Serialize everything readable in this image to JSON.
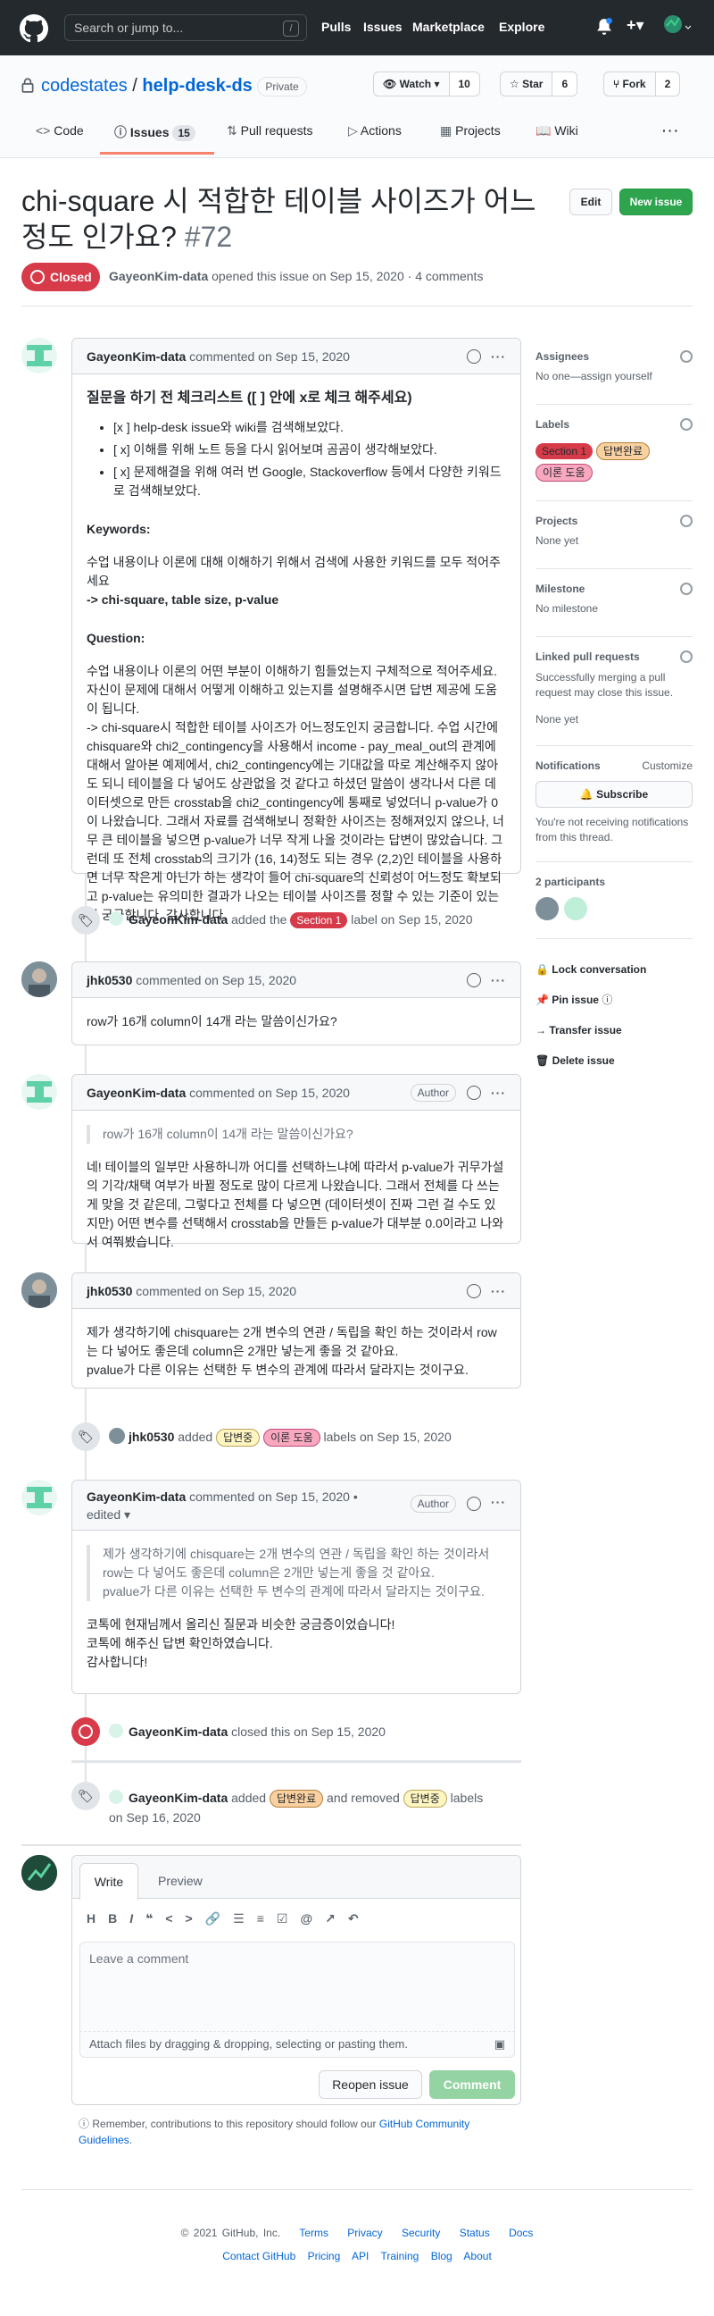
{
  "header": {
    "search_placeholder": "Search or jump to...",
    "slash_key": "/",
    "nav": [
      "Pulls",
      "Issues",
      "Marketplace",
      "Explore"
    ],
    "plus": "+▾"
  },
  "repo": {
    "owner": "codestates",
    "separator": "/",
    "name": "help-desk-ds",
    "visibility": "Private",
    "watch": "Watch ▾",
    "watch_count": "10",
    "star": "Star",
    "star_count": "6",
    "fork": "Fork",
    "fork_count": "2"
  },
  "tabs": [
    {
      "label": "Code"
    },
    {
      "label": "Issues",
      "count": "15"
    },
    {
      "label": "Pull requests"
    },
    {
      "label": "Actions"
    },
    {
      "label": "Projects"
    },
    {
      "label": "Wiki"
    }
  ],
  "issue": {
    "title": "chi-square 시 적합한 테이블 사이즈가 어느정도 인가요?",
    "number": "#72",
    "edit": "Edit",
    "new_issue": "New issue",
    "state": "Closed",
    "meta_author": "GayeonKim-data",
    "meta_text": "opened this issue on Sep 15, 2020 · 4 comments"
  },
  "comments": [
    {
      "author": "GayeonKim-data",
      "when": "commented on Sep 15, 2020",
      "heading": "질문을 하기 전 체크리스트 ([ ] 안에 x로 체크 해주세요)",
      "checklist": [
        "[x ] help-desk issue와 wiki를 검색해보았다.",
        "[ x] 이해를 위해 노트 등을 다시 읽어보며 곰곰이 생각해보았다.",
        "[ x] 문제해결을 위해 여러 번 Google, Stackoverflow 등에서 다양한 키워드로 검색해보았다."
      ],
      "kw_heading": "Keywords:",
      "kw_text": "수업 내용이나 이론에 대해 이해하기 위해서 검색에 사용한 키워드를 모두 적어주세요",
      "kw_value": "-> chi-square, table size, p-value",
      "q_heading": "Question:",
      "q_text": "수업 내용이나 이론의 어떤 부분이 이해하기 힘들었는지 구체적으로 적어주세요. 자신이 문제에 대해서 어떻게 이해하고 있는지를 설명해주시면 답변 제공에 도움이 됩니다.\n-> chi-square시 적합한 테이블 사이즈가 어느정도인지 궁금합니다. 수업 시간에 chisquare와 chi2_contingency을 사용해서 income - pay_meal_out의 관계에 대해서 알아본 예제에서, chi2_contingency에는 기대값을 따로 계산해주지 않아도 되니 테이블을 다 넣어도 상관없을 것 같다고 하셨던 말씀이 생각나서 다른 데이터셋으로 만든 crosstab을 chi2_contingency에 통째로 넣었더니 p-value가 0이 나왔습니다. 그래서 자료를 검색해보니 정확한 사이즈는 정해져있지 않으나, 너무 큰 테이블을 넣으면 p-value가 너무 작게 나올 것이라는 답변이 많았습니다. 그런데 또 전체 crosstab의 크기가 (16, 14)정도 되는 경우 (2,2)인 테이블을 사용하면 너무 작은게 아닌가 하는 생각이 들어 chi-square의 신뢰성이 어느정도 확보되고 p-value는 유의미한 결과가 나오는 테이블 사이즈를 정할 수 있는 기준이 있는지 궁금합니다. 감사합니다."
    },
    {
      "author": "jhk0530",
      "when": "commented on Sep 15, 2020",
      "text": "row가 16개 column이 14개 라는 말씀이신가요?"
    },
    {
      "author": "GayeonKim-data",
      "when": "commented on Sep 15, 2020",
      "badge": "Author",
      "quote": "row가 16개 column이 14개 라는 말씀이신가요?",
      "text": "네! 테이블의 일부만 사용하니까 어디를 선택하느냐에 따라서 p-value가 귀무가설의 기각/채택 여부가 바뀔 정도로 많이 다르게 나왔습니다. 그래서 전체를 다 쓰는게 맞을 것 같은데, 그렇다고 전체를 다 넣으면 (데이터셋이 진짜 그런 걸 수도 있지만) 어떤 변수를 선택해서 crosstab을 만들든 p-value가 대부분 0.0이라고 나와서 여쭤봤습니다."
    },
    {
      "author": "jhk0530",
      "when": "commented on Sep 15, 2020",
      "text": "제가 생각하기에 chisquare는 2개 변수의 연관 / 독립을 확인 하는 것이라서 row는 다 넣어도 좋은데 column은 2개만 넣는게 좋을 것 같아요.\npvalue가 다른 이유는 선택한 두 변수의 관계에 따라서 달라지는 것이구요."
    },
    {
      "author": "GayeonKim-data",
      "when": "commented on Sep 15, 2020 •",
      "edited": "edited ▾",
      "badge": "Author",
      "quote": "제가 생각하기에 chisquare는 2개 변수의 연관 / 독립을 확인 하는 것이라서 row는 다 넣어도 좋은데 column은 2개만 넣는게 좋을 것 같아요.\npvalue가 다른 이유는 선택한 두 변수의 관계에 따라서 달라지는 것이구요.",
      "text": "코톡에 현재님께서 올리신 질문과 비슷한 궁금증이었습니다!\n코톡에 해주신 답변 확인하였습니다.\n감사합니다!"
    }
  ],
  "events": {
    "label1": {
      "author": "GayeonKim-data",
      "pre": "added the",
      "label": "Section 1",
      "post": "label on Sep 15, 2020"
    },
    "label2": {
      "author": "jhk0530",
      "pre": "added",
      "label1": "답변중",
      "label2": "이론 도움",
      "post": "labels on Sep 15, 2020"
    },
    "closed": {
      "author": "GayeonKim-data",
      "text": "closed this on Sep 15, 2020"
    },
    "label3": {
      "author": "GayeonKim-data",
      "pre": "added",
      "label1": "답변완료",
      "mid": "and removed",
      "label2": "답변중",
      "post": "labels",
      "date": "on Sep 16, 2020"
    }
  },
  "sidebar": {
    "assignees": "Assignees",
    "assignees_value": "No one—assign yourself",
    "labels": "Labels",
    "labels_values": [
      "Section 1",
      "답변완료",
      "이론 도움"
    ],
    "projects": "Projects",
    "projects_value": "None yet",
    "milestone": "Milestone",
    "milestone_value": "No milestone",
    "linked": "Linked pull requests",
    "linked_desc": "Successfully merging a pull request may close this issue.",
    "linked_value": "None yet",
    "notifications": "Notifications",
    "customize": "Customize",
    "subscribe": "Subscribe",
    "notif_desc": "You're not receiving notifications from this thread.",
    "participants": "2 participants",
    "lock": "Lock conversation",
    "pin": "Pin issue",
    "transfer": "Transfer issue",
    "delete": "Delete issue"
  },
  "editor": {
    "tab_write": "Write",
    "tab_preview": "Preview",
    "placeholder": "Leave a comment",
    "attach": "Attach files by dragging & dropping, selecting or pasting them.",
    "reopen": "Reopen issue",
    "comment": "Comment",
    "reminder_pre": "Remember, contributions to this repository should follow our",
    "reminder_link": "GitHub Community Guidelines",
    "reminder_post": "."
  },
  "footer": {
    "copyright": "© 2021 GitHub, Inc.",
    "links1": [
      "Terms",
      "Privacy",
      "Security",
      "Status",
      "Docs"
    ],
    "links2": [
      "Contact GitHub",
      "Pricing",
      "API",
      "Training",
      "Blog",
      "About"
    ]
  },
  "colors": {
    "header_bg": "#24292e",
    "closed_red": "#d73a49",
    "green": "#2ea44f",
    "label_section1": "#d73a49",
    "label_done": "#f9d0a0",
    "label_theory": "#f9a8c0",
    "label_pending": "#fff5c0"
  }
}
